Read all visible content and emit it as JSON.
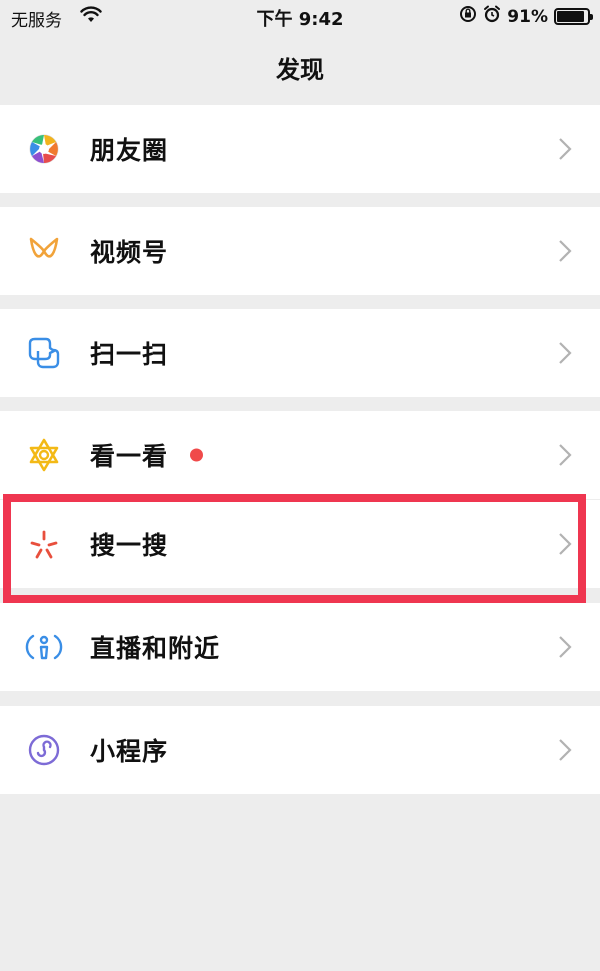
{
  "status_bar": {
    "carrier": "无服务",
    "time": "下午 9:42",
    "battery": "91%",
    "battery_level": 0.91
  },
  "header": {
    "title": "发现"
  },
  "items": [
    {
      "label": "朋友圈",
      "icon": "moments-icon"
    },
    {
      "label": "视频号",
      "icon": "channels-icon"
    },
    {
      "label": "扫一扫",
      "icon": "scan-icon"
    },
    {
      "label": "看一看",
      "icon": "top-stories-icon",
      "badge": "red-dot"
    },
    {
      "label": "搜一搜",
      "icon": "search-icon",
      "highlighted": true
    },
    {
      "label": "直播和附近",
      "icon": "live-nearby-icon"
    },
    {
      "label": "小程序",
      "icon": "mini-programs-icon"
    }
  ],
  "colors": {
    "background": "#ededed",
    "highlight_border": "#ef3650",
    "badge_dot": "#f04a4a"
  }
}
